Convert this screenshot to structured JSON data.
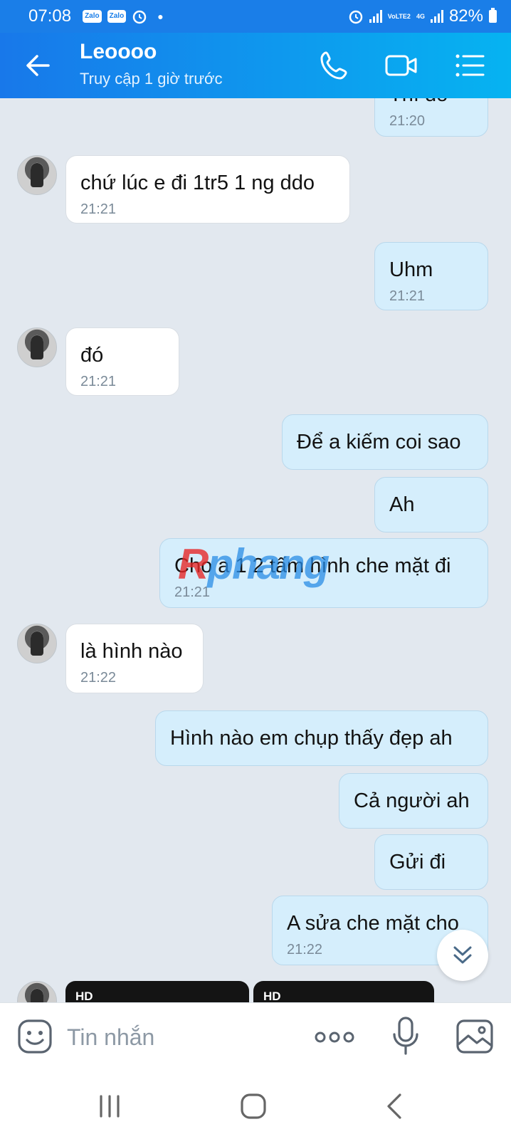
{
  "status_bar": {
    "time": "07:08",
    "notifications": [
      "Zalo",
      "Zalo"
    ],
    "network_type_top": "VoLTE2",
    "network_type_bottom": "4G",
    "battery": "82%",
    "icons": [
      "alarm-icon",
      "signal-icon",
      "battery-icon"
    ]
  },
  "header": {
    "contact_name": "Leoooo",
    "last_seen": "Truy cập 1 giờ trước",
    "icons": [
      "back-arrow-icon",
      "phone-icon",
      "video-call-icon",
      "menu-list-icon"
    ]
  },
  "messages": [
    {
      "dir": "out",
      "text": "Thì đó",
      "time": "21:20"
    },
    {
      "dir": "in",
      "text": "chứ lúc e đi 1tr5 1 ng ddo",
      "time": "21:21"
    },
    {
      "dir": "out",
      "text": "Uhm",
      "time": "21:21"
    },
    {
      "dir": "in",
      "text": "đó",
      "time": "21:21"
    },
    {
      "dir": "out",
      "text": "Để a kiếm coi sao",
      "time": ""
    },
    {
      "dir": "out",
      "text": "Ah",
      "time": ""
    },
    {
      "dir": "out",
      "text": "Cho a 1 2 tấm hình che mặt đi",
      "time": "21:21"
    },
    {
      "dir": "in",
      "text": "là hình nào",
      "time": "21:22"
    },
    {
      "dir": "out",
      "text": "Hình nào em chụp thấy đẹp ah",
      "time": ""
    },
    {
      "dir": "out",
      "text": "Cả người ah",
      "time": ""
    },
    {
      "dir": "out",
      "text": "Gửi đi",
      "time": ""
    },
    {
      "dir": "out",
      "text": "A sửa che mặt cho",
      "time": "21:22"
    }
  ],
  "media_badges": [
    "HD",
    "HD"
  ],
  "watermark": {
    "part1": "R",
    "part2": "phang"
  },
  "composer": {
    "placeholder": "Tin nhắn",
    "value": "",
    "icons": [
      "emoji-icon",
      "more-dots-icon",
      "microphone-icon",
      "image-icon"
    ]
  },
  "nav_bar": {
    "icons": [
      "recent-apps-icon",
      "home-icon",
      "back-icon"
    ]
  },
  "colors": {
    "header_gradient_start": "#1878ea",
    "header_gradient_end": "#06b3f1",
    "chat_background": "#e2e8ef",
    "outgoing_bubble": "#d5eefc",
    "incoming_bubble": "#ffffff"
  }
}
